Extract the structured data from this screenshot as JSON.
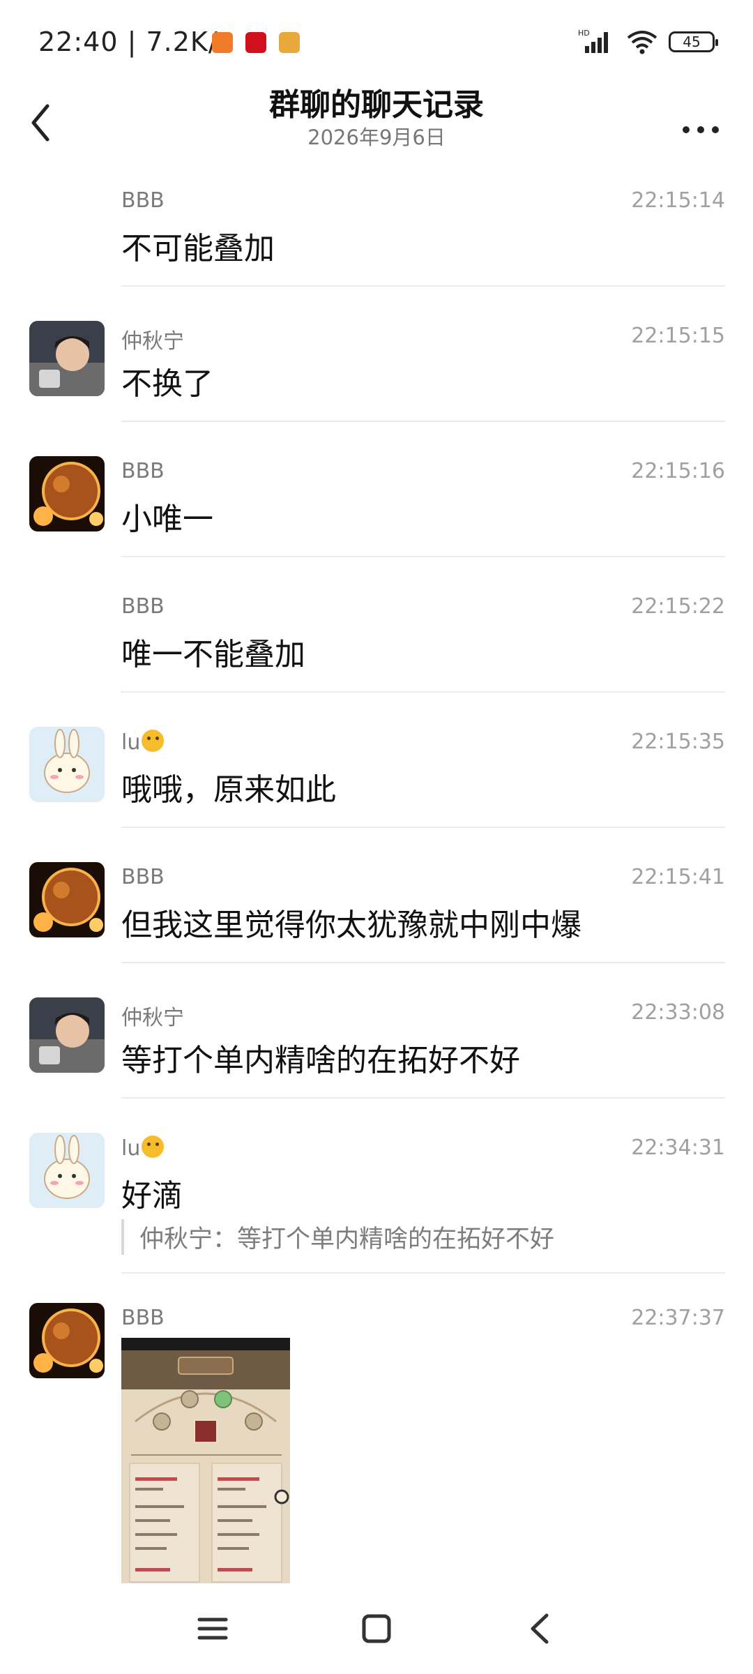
{
  "status_bar": {
    "time": "22:40 | 7.2K/s",
    "signal_badge": "HD",
    "battery": "45"
  },
  "header": {
    "title": "群聊的聊天记录",
    "date": "2026年9月6日"
  },
  "messages": [
    {
      "sender": "BBB",
      "time": "22:15:14",
      "text": "不可能叠加"
    },
    {
      "sender": "仲秋宁",
      "time": "22:15:15",
      "text": "不换了"
    },
    {
      "sender": "BBB",
      "time": "22:15:16",
      "text": "小唯一"
    },
    {
      "sender": "BBB",
      "time": "22:15:22",
      "text": "唯一不能叠加"
    },
    {
      "sender": "lu",
      "time": "22:15:35",
      "text": "哦哦，原来如此"
    },
    {
      "sender": "BBB",
      "time": "22:15:41",
      "text": "但我这里觉得你太犹豫就中刚中爆"
    },
    {
      "sender": "仲秋宁",
      "time": "22:33:08",
      "text": "等打个单内精啥的在拓好不好"
    },
    {
      "sender": "lu",
      "time": "22:34:31",
      "text": "好滴",
      "quote": "仲秋宁：等打个单内精啥的在拓好不好"
    },
    {
      "sender": "BBB",
      "time": "22:37:37",
      "image": "game-screenshot"
    }
  ],
  "icons": {
    "back": "chevron-left-icon",
    "more": "more-dots-icon",
    "nav_menu": "menu-icon",
    "nav_home": "home-square-icon",
    "nav_back": "back-triangle-icon"
  },
  "colors": {
    "sender": "#7a7a7a",
    "timestamp": "#a0a0a0",
    "divider": "#ececec"
  }
}
